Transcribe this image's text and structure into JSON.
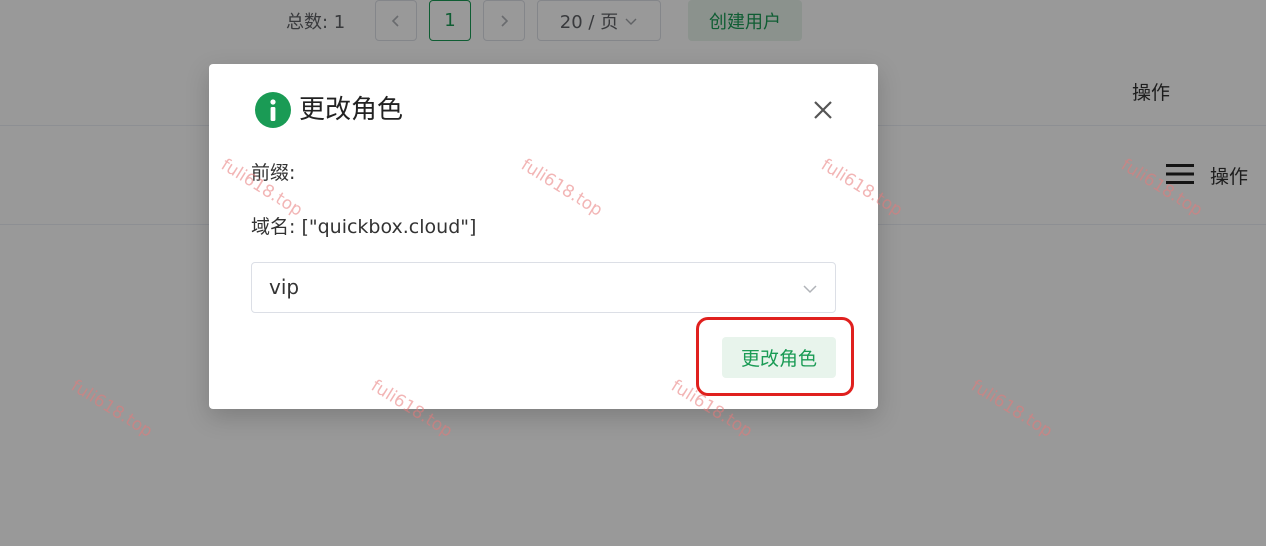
{
  "pagination": {
    "total_label": "总数: 1",
    "prev_icon": "chevron-left-icon",
    "current_page": "1",
    "next_icon": "chevron-right-icon",
    "page_size": "20 / 页",
    "create_user_label": "创建用户"
  },
  "table": {
    "header_action_label": "操作",
    "row_action_label": "操作",
    "row_menu_icon": "hamburger-menu-icon"
  },
  "dialog": {
    "icon": "info-icon",
    "title": "更改角色",
    "prefix_line": "前缀:",
    "domain_line": "域名: [\"quickbox.cloud\"]",
    "role_select_value": "vip",
    "confirm_label": "更改角色",
    "close_icon": "close-icon"
  },
  "watermark": {
    "text": "fuli618.top"
  },
  "colors": {
    "accent": "#1a9b55",
    "accent_bg": "#e8f4ec",
    "highlight": "#e0201e"
  }
}
